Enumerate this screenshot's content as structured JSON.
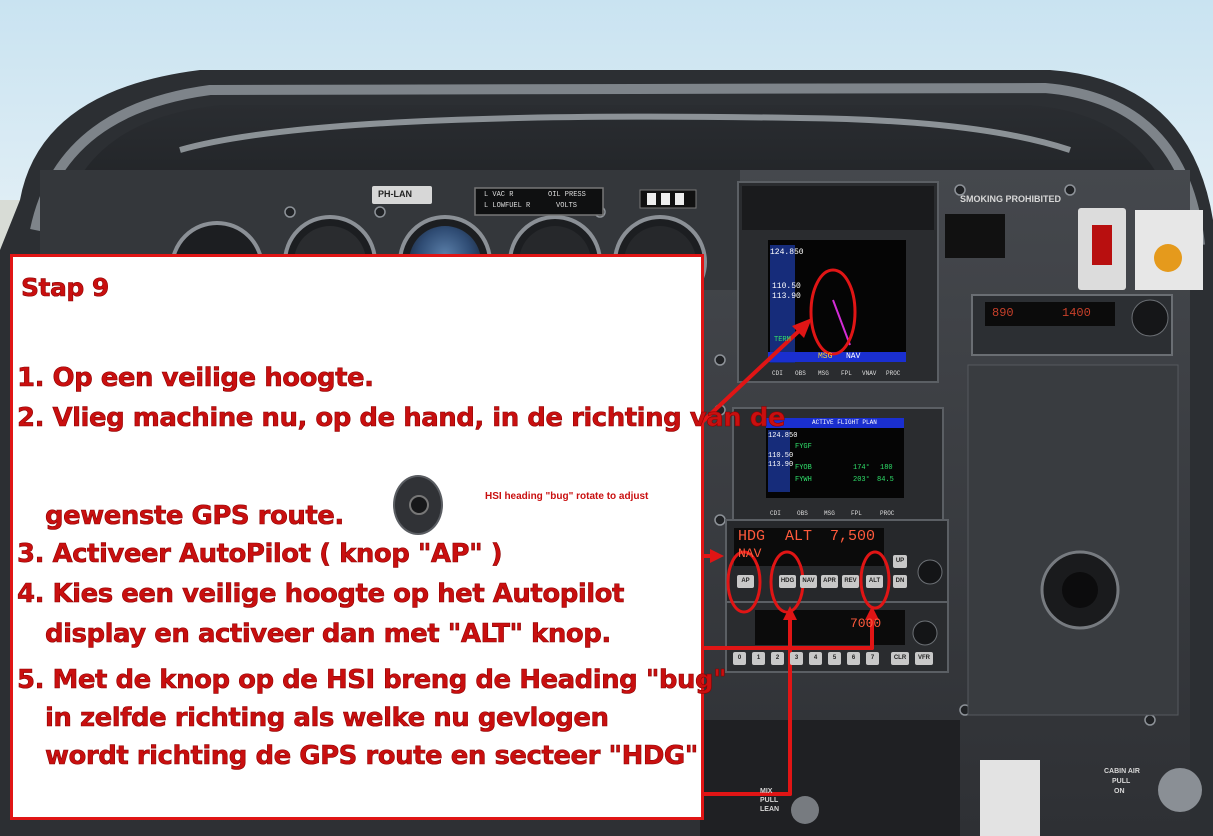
{
  "cockpit": {
    "registration": "PH-LAN",
    "annunciator_left": [
      "L VAC R",
      "L LOWFUEL R"
    ],
    "annunciator_right": [
      "OIL PRESS",
      "VOLTS"
    ],
    "smoking_sign": "SMOKING PROHIBITED",
    "gps_top": {
      "freq_active": "124.850",
      "freq_nav": "110.50",
      "freq_nav2": "113.90",
      "msg": "MSG",
      "nav": "NAV",
      "term": "TERM",
      "softkeys": [
        "CDI",
        "OBS",
        "MSG",
        "FPL",
        "VNAV",
        "PROC"
      ]
    },
    "gps_bottom": {
      "header": "ACTIVE FLIGHT PLAN",
      "freq_active": "124.850",
      "freq_nav": "110.50",
      "freq_nav2": "113.90",
      "waypoints": [
        "FYGF",
        "FYOB",
        "FYWH"
      ],
      "legs": [
        {
          "dtk": "174°",
          "dis": "180"
        },
        {
          "dtk": "203°",
          "dis": "84.5"
        }
      ],
      "softkeys": [
        "CDI",
        "OBS",
        "MSG",
        "FPL",
        "PROC"
      ]
    },
    "autopilot": {
      "mode_lateral": "HDG",
      "mode_vertical": "ALT",
      "altitude": "7,500",
      "armed": "NAV",
      "buttons": [
        "AP",
        "HDG",
        "NAV",
        "APR",
        "REV",
        "ALT"
      ],
      "right_buttons": [
        "UP",
        "DN"
      ]
    },
    "transponder": {
      "code": "7000",
      "buttons": [
        "0",
        "1",
        "2",
        "3",
        "4",
        "5",
        "6",
        "7",
        "CLR",
        "VFR"
      ]
    },
    "radio_right": {
      "freq_a": "890",
      "freq_b": "1400"
    },
    "lever_labels": [
      "MIX",
      "PULL",
      "LEAN"
    ],
    "cabin_air": [
      "CABIN AIR",
      "PULL",
      "ON"
    ]
  },
  "instructions": {
    "title": "Stap 9",
    "step1": "1. Op een veilige hoogte.",
    "step2_line1": "2. Vlieg machine nu, op de hand, in de richting van de",
    "step2_line2": "gewenste GPS route.",
    "hsi_note": "HSI heading \"bug\" rotate to adjust",
    "step3": "3. Activeer AutoPilot ( knop \"AP\" )",
    "step4_line1": "4. Kies een veilige hoogte op het Autopilot",
    "step4_line2": "display en activeer dan met \"ALT\" knop.",
    "step5_line1": "5. Met de knop op de HSI breng de Heading \"bug\"",
    "step5_line2": "in zelfde richting als welke nu gevlogen",
    "step5_line3": "wordt richting de GPS route en secteer \"HDG\""
  },
  "colors": {
    "accent_red": "#e01515",
    "text_red": "#c90f0f",
    "panel_grey": "#3a3d41",
    "gps_blue": "#1a2fd0"
  }
}
